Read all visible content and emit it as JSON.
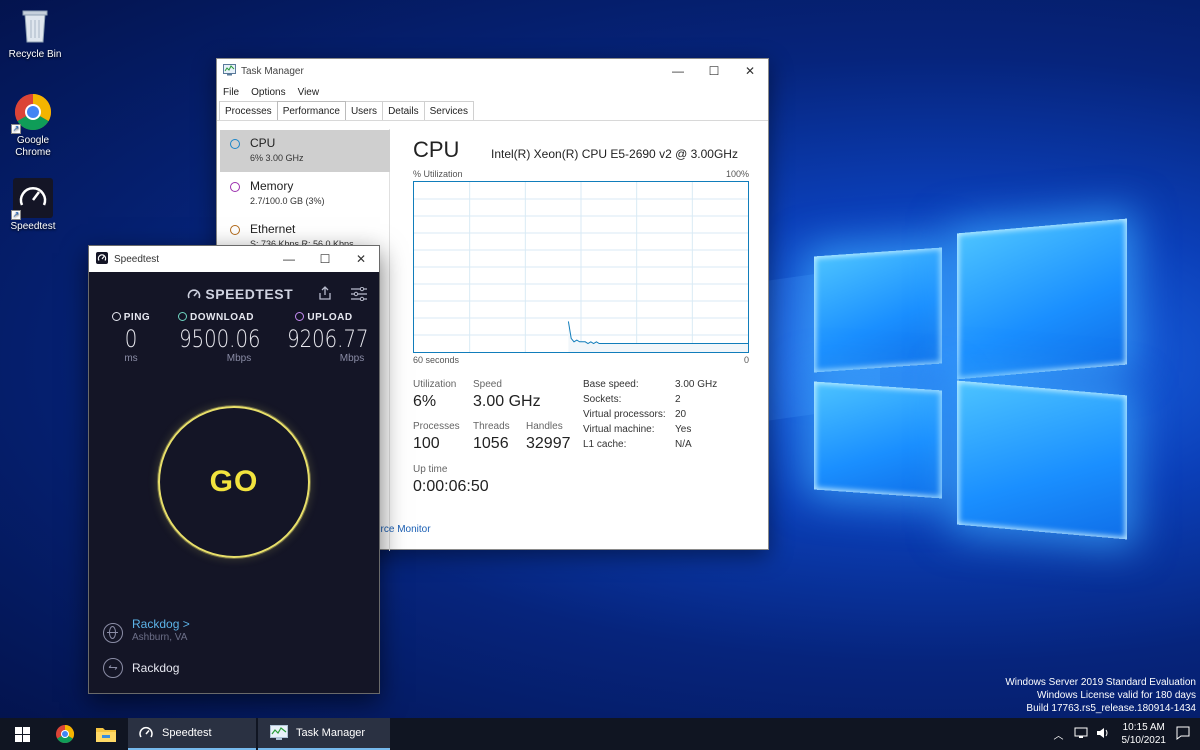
{
  "desktop": {
    "icons": [
      {
        "label": "Recycle Bin",
        "icon": "recycle-bin-icon"
      },
      {
        "label": "Google Chrome",
        "icon": "chrome-icon"
      },
      {
        "label": "Speedtest",
        "icon": "speedtest-icon"
      }
    ],
    "watermark": {
      "line1": "Windows Server 2019 Standard Evaluation",
      "line2": "Windows License valid for 180 days",
      "line3": "Build 17763.rs5_release.180914-1434"
    }
  },
  "task_manager": {
    "title": "Task Manager",
    "menu": [
      "File",
      "Options",
      "View"
    ],
    "tabs": [
      "Processes",
      "Performance",
      "Users",
      "Details",
      "Services"
    ],
    "active_tab": "Performance",
    "sidebar": [
      {
        "name": "CPU",
        "detail": "6% 3.00 GHz",
        "color": "#1a85c9"
      },
      {
        "name": "Memory",
        "detail": "2.7/100.0 GB (3%)",
        "color": "#9b2fae"
      },
      {
        "name": "Ethernet",
        "detail": "S: 736 Kbps R: 56.0 Kbps",
        "color": "#b36a1a"
      }
    ],
    "main": {
      "heading": "CPU",
      "model": "Intel(R) Xeon(R) CPU E5-2690 v2 @ 3.00GHz",
      "util_label": "% Utilization",
      "util_max": "100%",
      "time_left": "60 seconds",
      "time_right": "0",
      "stats": {
        "utilization_label": "Utilization",
        "utilization": "6%",
        "speed_label": "Speed",
        "speed": "3.00 GHz",
        "processes_label": "Processes",
        "processes": "100",
        "threads_label": "Threads",
        "threads": "1056",
        "handles_label": "Handles",
        "handles": "32997",
        "uptime_label": "Up time",
        "uptime": "0:00:06:50"
      },
      "specs": [
        {
          "k": "Base speed:",
          "v": "3.00 GHz"
        },
        {
          "k": "Sockets:",
          "v": "2"
        },
        {
          "k": "Virtual processors:",
          "v": "20"
        },
        {
          "k": "Virtual machine:",
          "v": "Yes"
        },
        {
          "k": "L1 cache:",
          "v": "N/A"
        }
      ],
      "resource_link": "urce Monitor"
    },
    "graph_series": [
      0,
      0,
      0,
      0,
      0,
      0,
      0,
      0,
      0,
      0,
      0,
      0,
      0,
      0,
      0,
      0,
      0,
      0,
      0,
      0,
      0,
      0,
      0,
      0,
      0,
      0,
      0,
      0,
      0,
      0,
      0,
      0,
      0,
      0,
      0,
      0,
      0,
      0,
      0,
      0,
      0,
      0,
      0,
      0,
      0,
      0,
      0,
      0,
      0,
      0,
      0,
      0,
      0,
      0,
      0,
      18,
      8,
      6,
      7,
      6,
      6,
      6,
      5,
      6,
      5,
      6,
      5,
      5,
      5,
      5,
      5,
      5,
      5,
      5,
      5,
      5,
      5,
      5,
      5,
      5,
      5,
      5,
      5,
      5,
      5,
      5,
      5,
      5,
      5,
      5,
      5,
      5,
      5,
      5,
      5,
      5,
      5,
      5,
      5,
      5,
      5,
      5,
      5,
      5,
      5,
      5,
      5,
      5,
      5,
      5,
      5,
      5,
      5,
      5,
      5,
      5,
      5,
      5,
      5,
      5
    ]
  },
  "speedtest": {
    "title": "Speedtest",
    "brand": "SPEEDTEST",
    "ping": {
      "label": "PING",
      "value": "0",
      "unit": "ms"
    },
    "download": {
      "label": "DOWNLOAD",
      "value": "9500.06",
      "unit": "Mbps"
    },
    "upload": {
      "label": "UPLOAD",
      "value": "9206.77",
      "unit": "Mbps"
    },
    "go": "GO",
    "server": {
      "name": "Rackdog",
      "chevron": ">",
      "location": "Ashburn, VA"
    },
    "provider": "Rackdog",
    "colors": {
      "accent": "#f2e33e",
      "link": "#5cb3e8"
    }
  },
  "taskbar": {
    "apps": [
      {
        "label": "Speedtest"
      },
      {
        "label": "Task Manager"
      }
    ],
    "clock_time": "10:15 AM",
    "clock_date": "5/10/2021"
  }
}
